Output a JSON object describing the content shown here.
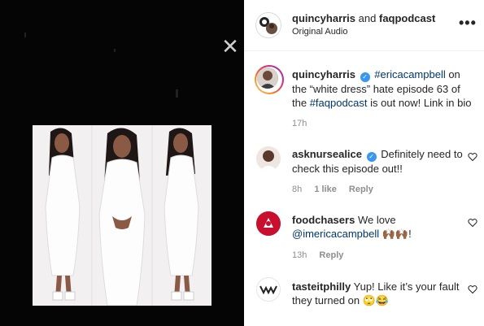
{
  "viewer": {
    "close_icon": "close-icon",
    "close_glyph": "✕"
  },
  "header": {
    "user1": "quincyharris",
    "conj": "and",
    "user2": "faqpodcast",
    "audio": "Original Audio",
    "more_glyph": "•••"
  },
  "caption": {
    "username": "quincyharris",
    "verified": "✓",
    "mention": "#ericacampbell",
    "text1": " on the “white dress” hate episode 63 of the ",
    "hashtag": "#faqpodcast",
    "text2": " is out now! Link in bio",
    "time": "17h"
  },
  "comments": [
    {
      "username": "asknursealice",
      "verified": "✓",
      "text": "Definitely need to check this episode out!!",
      "time": "8h",
      "likes": "1 like",
      "reply": "Reply"
    },
    {
      "username": "foodchasers",
      "text_before": "We love",
      "mention": "@imericacampbell",
      "emoji": "🙌🏾🙌🏾!",
      "time": "13h",
      "reply": "Reply"
    },
    {
      "username": "tasteitphilly",
      "text": "Yup! Like it’s your fault they turned on 🙄😂"
    }
  ],
  "icons": {
    "heart": "heart-icon"
  },
  "colors": {
    "link": "#00376b",
    "verified": "#3897f0",
    "muted": "#8e8e8e"
  }
}
